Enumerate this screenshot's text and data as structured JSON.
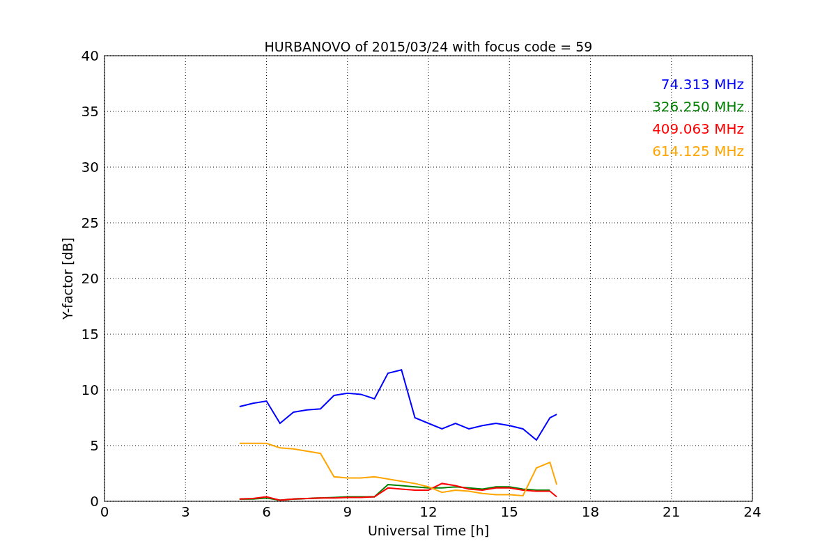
{
  "chart_data": {
    "type": "line",
    "title": "HURBANOVO of 2015/03/24 with focus code = 59",
    "xlabel": "Universal Time [h]",
    "ylabel": "Y-factor [dB]",
    "grid": true,
    "x": [
      5,
      5.5,
      6,
      6.5,
      7,
      7.5,
      8,
      8.5,
      9,
      9.5,
      10,
      10.5,
      11,
      11.5,
      12,
      12.5,
      13,
      13.5,
      14,
      14.5,
      15,
      15.5,
      16,
      16.5,
      16.75
    ],
    "series": [
      {
        "name": "74.313 MHz",
        "color": "#0000ff",
        "values": [
          8.5,
          8.8,
          9,
          7,
          8,
          8.2,
          8.3,
          9.5,
          9.7,
          9.6,
          9.2,
          11.5,
          11.8,
          7.5,
          7,
          6.5,
          7,
          6.5,
          6.8,
          7,
          6.8,
          6.5,
          5.5,
          7.5,
          7.8
        ]
      },
      {
        "name": "326.250 MHz",
        "color": "#008000",
        "values": [
          0.2,
          0.2,
          0.3,
          0.1,
          0.2,
          0.25,
          0.3,
          0.35,
          0.4,
          0.4,
          0.4,
          1.5,
          1.4,
          1.3,
          1.2,
          1.2,
          1.3,
          1.2,
          1.1,
          1.3,
          1.3,
          1.1,
          1,
          1,
          null
        ]
      },
      {
        "name": "409.063 MHz",
        "color": "#ff0000",
        "values": [
          0.2,
          0.25,
          0.4,
          0.1,
          0.2,
          0.25,
          0.3,
          0.3,
          0.35,
          0.35,
          0.4,
          1.2,
          1.1,
          1,
          1,
          1.6,
          1.4,
          1.1,
          1,
          1.2,
          1.2,
          1,
          0.9,
          0.9,
          0.4
        ]
      },
      {
        "name": "614.125 MHz",
        "color": "#ffa500",
        "values": [
          5.2,
          5.2,
          5.2,
          4.8,
          4.7,
          4.5,
          4.3,
          2.2,
          2.1,
          2.1,
          2.2,
          2,
          1.8,
          1.6,
          1.3,
          0.8,
          1,
          0.9,
          0.7,
          0.6,
          0.6,
          0.5,
          3,
          3.5,
          1.5
        ]
      }
    ],
    "xlim": [
      0,
      24
    ],
    "ylim": [
      0,
      40
    ],
    "xticks": [
      0,
      3,
      6,
      9,
      12,
      15,
      18,
      21,
      24
    ],
    "yticks": [
      0,
      5,
      10,
      15,
      20,
      25,
      30,
      35,
      40
    ]
  }
}
